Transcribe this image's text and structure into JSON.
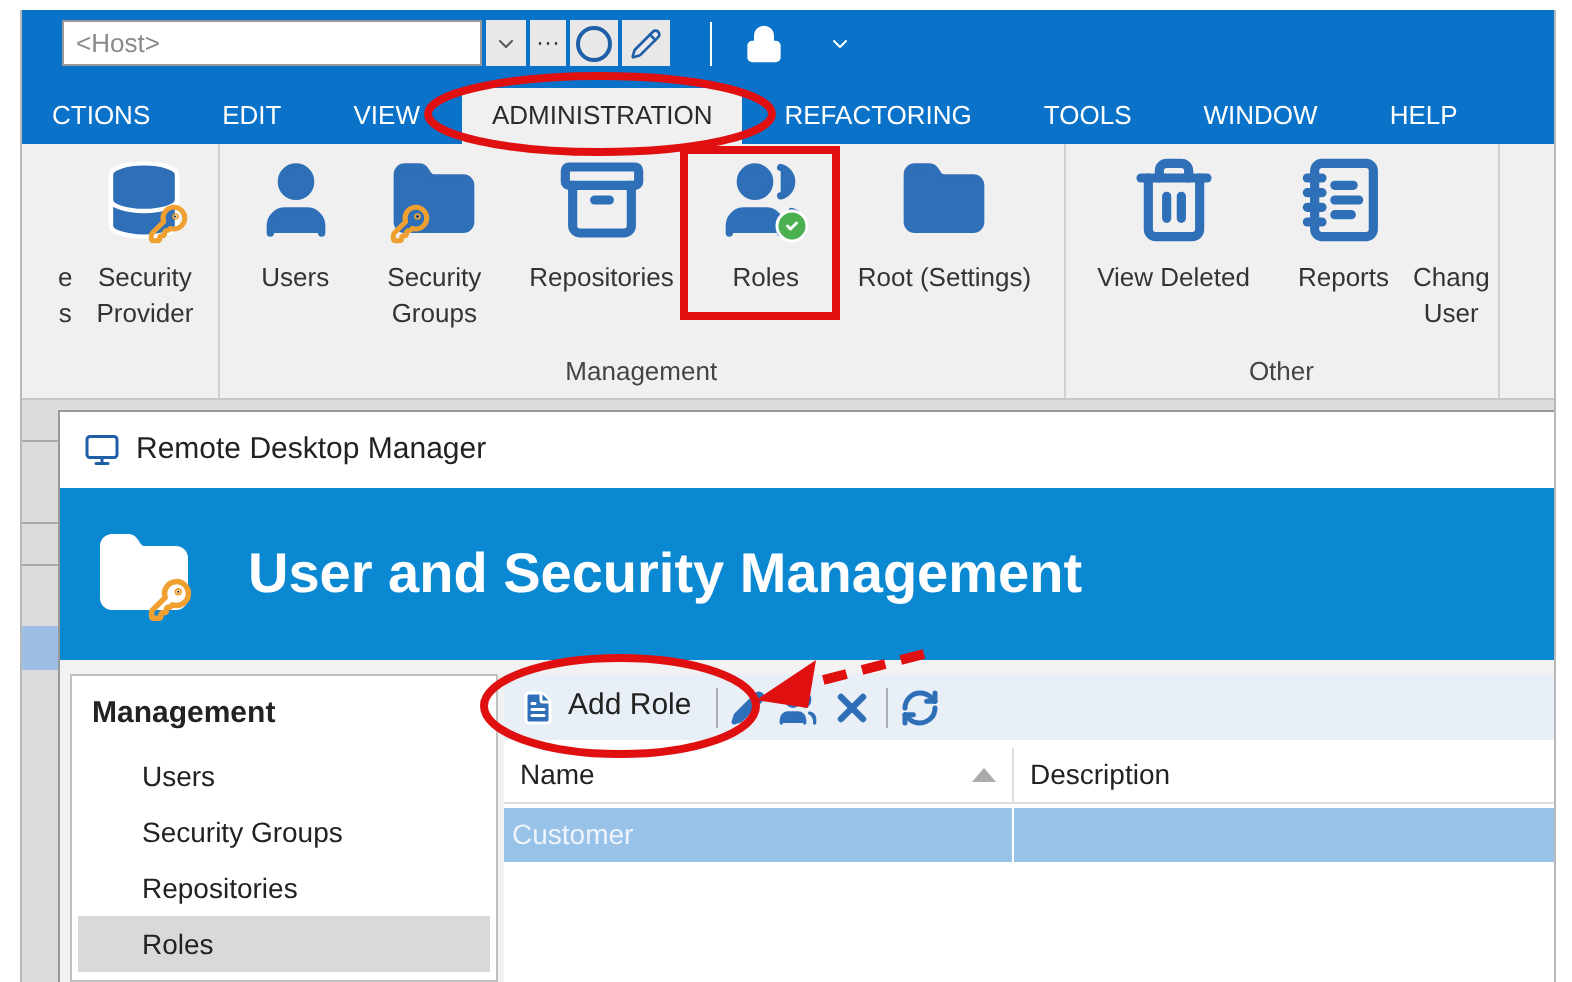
{
  "toolbar": {
    "host_placeholder": "<Host>",
    "more": "···"
  },
  "menu": [
    {
      "label": "CTIONS",
      "selected": false
    },
    {
      "label": "EDIT",
      "selected": false
    },
    {
      "label": "VIEW",
      "selected": false
    },
    {
      "label": "ADMINISTRATION",
      "selected": true
    },
    {
      "label": "REFACTORING",
      "selected": false
    },
    {
      "label": "TOOLS",
      "selected": false
    },
    {
      "label": "WINDOW",
      "selected": false
    },
    {
      "label": "HELP",
      "selected": false
    }
  ],
  "ribbon": [
    {
      "items": [
        {
          "kind": "partial",
          "lines": [
            "e",
            "s"
          ]
        },
        {
          "kind": "database",
          "lines": [
            "Security",
            "Provider"
          ]
        }
      ]
    },
    {
      "label": "Management",
      "items": [
        {
          "kind": "user",
          "lines": [
            "Users"
          ]
        },
        {
          "kind": "folder-key",
          "lines": [
            "Security",
            "Groups"
          ]
        },
        {
          "kind": "cabinet",
          "lines": [
            "Repositories"
          ]
        },
        {
          "kind": "roles",
          "lines": [
            "Roles"
          ]
        },
        {
          "kind": "folder",
          "lines": [
            "Root (Settings)"
          ]
        }
      ]
    },
    {
      "label": "Other",
      "items": [
        {
          "kind": "trash",
          "lines": [
            "View Deleted"
          ]
        },
        {
          "kind": "notebook",
          "lines": [
            "Reports"
          ]
        },
        {
          "kind": "cut",
          "lines": [
            "Chang",
            "User"
          ]
        }
      ]
    }
  ],
  "dialog": {
    "title": "Remote Desktop Manager",
    "header": "User and Security Management",
    "sidebar": {
      "heading": "Management",
      "items": [
        {
          "label": "Users",
          "selected": false
        },
        {
          "label": "Security Groups",
          "selected": false
        },
        {
          "label": "Repositories",
          "selected": false
        },
        {
          "label": "Roles",
          "selected": true
        }
      ]
    },
    "add_button": "Add Role",
    "table": {
      "columns": [
        {
          "label": "Name",
          "sorted": true
        },
        {
          "label": "Description",
          "sorted": false
        }
      ],
      "rows": [
        {
          "cells": [
            "Customer",
            ""
          ],
          "selected": true
        }
      ]
    }
  }
}
